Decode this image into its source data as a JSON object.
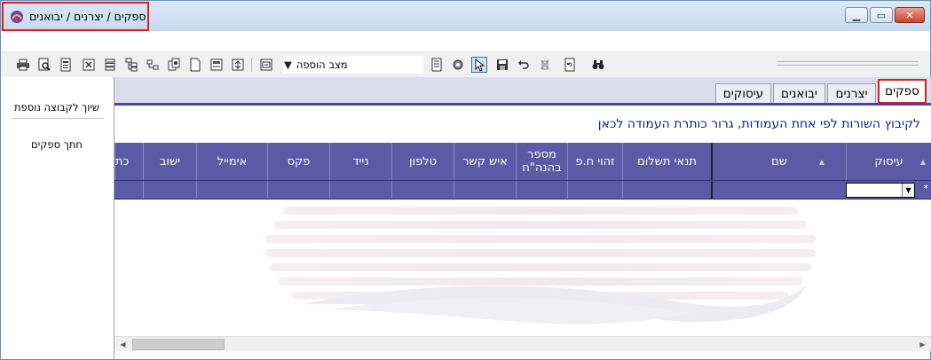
{
  "window": {
    "title": "ספקים / יצרנים / יבואנים",
    "controls": [
      "minimize-icon",
      "maximize-icon",
      "close-icon"
    ]
  },
  "toolbar": {
    "mode_label": "מצב הוספה",
    "icons_left_group": [
      "printer-icon",
      "print-preview-icon",
      "report-icon",
      "export-excel-icon",
      "list-icon",
      "tree-icon",
      "subtree-icon",
      "copy-icon",
      "new-document-icon",
      "layout-icon",
      "fit-icon",
      "filter-icon"
    ],
    "icons_right_group": [
      "columns-icon",
      "settings-icon",
      "edit-cursor-icon",
      "save-icon",
      "undo-icon",
      "delete-icon",
      "refresh-icon",
      "binoculars-icon"
    ],
    "active_icon": "edit-cursor-icon"
  },
  "sidebar": {
    "items": [
      {
        "label": "שיוך לקבוצה נוספת"
      },
      {
        "label": "חתך ספקים"
      }
    ]
  },
  "tabs": [
    {
      "label": "ספקים",
      "active": true
    },
    {
      "label": "יצרנים",
      "active": false
    },
    {
      "label": "יבואנים",
      "active": false
    },
    {
      "label": "עיסוקים",
      "active": false
    }
  ],
  "grid": {
    "group_hint": "לקיבוץ השורות לפי אחת העמודות, גרור כותרת העמודה לכאן",
    "columns": [
      {
        "label": "עיסוק",
        "sorted": true
      },
      {
        "label": "שם",
        "sorted": true
      },
      {
        "label": "תנאי תשלום",
        "sorted": false
      },
      {
        "label": "זהוי ח.פ",
        "sorted": false
      },
      {
        "label": "מספר בהנה\"ח",
        "sorted": false
      },
      {
        "label": "איש קשר",
        "sorted": false
      },
      {
        "label": "טלפון",
        "sorted": false
      },
      {
        "label": "נייד",
        "sorted": false
      },
      {
        "label": "פקס",
        "sorted": false
      },
      {
        "label": "אימייל",
        "sorted": false
      },
      {
        "label": "ישוב",
        "sorted": false
      },
      {
        "label": "כת",
        "sorted": false
      }
    ],
    "new_row_marker": "*"
  },
  "colors": {
    "header_bg": "#5a5aa6",
    "tab_underline": "#3f47b3",
    "highlight": "#e0201f"
  }
}
